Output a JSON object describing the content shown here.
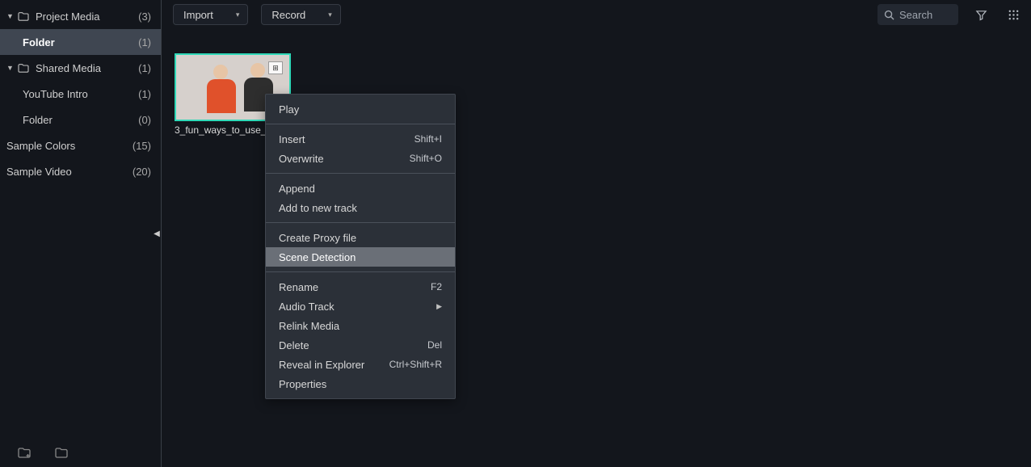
{
  "sidebar": {
    "items": [
      {
        "label": "Project Media",
        "count": "(3)",
        "caret": true,
        "folder": true,
        "indent": false,
        "selected": false
      },
      {
        "label": "Folder",
        "count": "(1)",
        "caret": false,
        "folder": false,
        "indent": true,
        "selected": true
      },
      {
        "label": "Shared Media",
        "count": "(1)",
        "caret": true,
        "folder": true,
        "indent": false,
        "selected": false
      },
      {
        "label": "YouTube Intro",
        "count": "(1)",
        "caret": false,
        "folder": false,
        "indent": true,
        "selected": false
      },
      {
        "label": "Folder",
        "count": "(0)",
        "caret": false,
        "folder": false,
        "indent": true,
        "selected": false
      },
      {
        "label": "Sample Colors",
        "count": "(15)",
        "caret": false,
        "folder": false,
        "indent": false,
        "selected": false,
        "noicon": true
      },
      {
        "label": "Sample Video",
        "count": "(20)",
        "caret": false,
        "folder": false,
        "indent": false,
        "selected": false,
        "noicon": true
      }
    ]
  },
  "toolbar": {
    "import_label": "Import",
    "record_label": "Record",
    "search_placeholder": "Search"
  },
  "clip": {
    "filename": "3_fun_ways_to_use_"
  },
  "context_menu": {
    "items": [
      {
        "label": "Play"
      },
      {
        "sep": true
      },
      {
        "label": "Insert",
        "shortcut": "Shift+I"
      },
      {
        "label": "Overwrite",
        "shortcut": "Shift+O"
      },
      {
        "sep": true
      },
      {
        "label": "Append"
      },
      {
        "label": "Add to new track"
      },
      {
        "sep": true
      },
      {
        "label": "Create Proxy file"
      },
      {
        "label": "Scene Detection",
        "hover": true
      },
      {
        "sep": true
      },
      {
        "label": "Rename",
        "shortcut": "F2"
      },
      {
        "label": "Audio Track",
        "submenu": true
      },
      {
        "label": "Relink Media"
      },
      {
        "label": "Delete",
        "shortcut": "Del"
      },
      {
        "label": "Reveal in Explorer",
        "shortcut": "Ctrl+Shift+R"
      },
      {
        "label": "Properties"
      }
    ]
  }
}
